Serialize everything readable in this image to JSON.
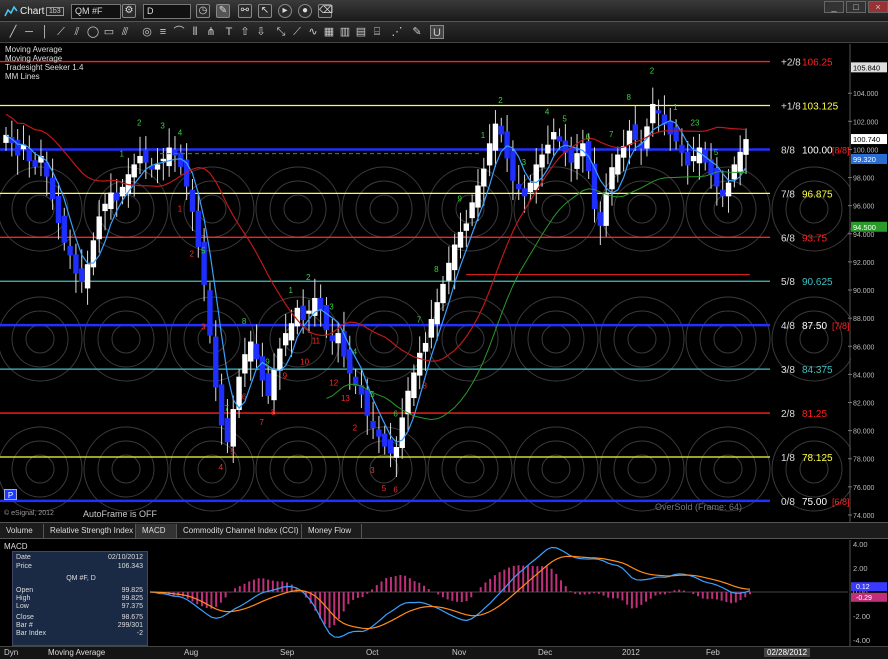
{
  "window": {
    "title": "Chart",
    "badge": "1b3",
    "symbol": "QM #F",
    "interval": "D"
  },
  "studies_list": [
    "Moving Average",
    "Moving Average",
    "Tradesight Seeker 1.4",
    "MM Lines"
  ],
  "chart_data": {
    "type": "candlestick",
    "ylim": [
      73.5,
      107.5
    ],
    "price_axis_ticks": [
      "74.000",
      "76.000",
      "78.000",
      "80.000",
      "82.000",
      "84.000",
      "86.000",
      "88.000",
      "90.000",
      "92.000",
      "94.000",
      "96.000",
      "98.000",
      "100.000",
      "102.000",
      "104.000"
    ],
    "current_price": "100.740",
    "ma_label_1": "99.320",
    "ma_label_2": "94.500",
    "top_label": "105.840",
    "mm_lines": [
      {
        "label": "+2/8",
        "value": "106.250",
        "color": "#ff2020"
      },
      {
        "label": "+1/8",
        "value": "103.125",
        "color": "#ffff40"
      },
      {
        "label": "8/8",
        "value": "100.000",
        "color": "#2030ff",
        "extra": "[8/8]"
      },
      {
        "label": "7/8",
        "value": "96.875",
        "color": "#ffff40"
      },
      {
        "label": "6/8",
        "value": "93.750",
        "color": "#ff2020"
      },
      {
        "label": "5/8",
        "value": "90.625",
        "color": "#40c0c0"
      },
      {
        "label": "4/8",
        "value": "87.500",
        "color": "#2030ff",
        "extra": "[7/8]"
      },
      {
        "label": "3/8",
        "value": "84.375",
        "color": "#40c0c0"
      },
      {
        "label": "2/8",
        "value": "81.250",
        "color": "#ff2020"
      },
      {
        "label": "1/8",
        "value": "78.125",
        "color": "#ffff40"
      },
      {
        "label": "0/8",
        "value": "75.000",
        "color": "#2030ff",
        "extra": "[6/8]"
      }
    ],
    "x_labels": [
      "Aug",
      "Sep",
      "Oct",
      "Nov",
      "Dec",
      "2012",
      "Feb"
    ],
    "closes": [
      101,
      100.5,
      99.6,
      100.3,
      99.2,
      98.8,
      99.5,
      98.1,
      96.5,
      94.8,
      93.4,
      92.5,
      91.2,
      90.6,
      91.8,
      93.5,
      95.2,
      96.1,
      96.9,
      96.4,
      97.3,
      98.2,
      98.9,
      99.5,
      99.1,
      98.6,
      98.9,
      99.3,
      100.1,
      99.6,
      98.8,
      97.4,
      95.6,
      93.1,
      90.4,
      86.8,
      83.1,
      80.4,
      79.2,
      81.5,
      83.8,
      85.4,
      86.3,
      85.1,
      83.6,
      82.5,
      84.3,
      85.8,
      86.9,
      87.6,
      88.7,
      87.9,
      88.5,
      89.4,
      88.6,
      87.2,
      86.4,
      86.9,
      85.3,
      84.1,
      83.2,
      82.6,
      81.1,
      80.2,
      79.6,
      78.9,
      78.4,
      78.8,
      80.9,
      82.8,
      84.1,
      85.5,
      86.2,
      87.9,
      89.1,
      90.4,
      91.9,
      93.2,
      94.1,
      94.7,
      96.2,
      97.4,
      98.6,
      100.4,
      101.8,
      101.1,
      99.4,
      97.8,
      97.2,
      96.7,
      97.6,
      98.9,
      99.6,
      100.3,
      101.2,
      100.6,
      99.8,
      99.1,
      99.7,
      100.4,
      98.5,
      95.8,
      94.6,
      96.9,
      98.7,
      99.6,
      100.2,
      101.3,
      100.7,
      100.1,
      101.6,
      103.2,
      102.6,
      101.8,
      101.1,
      100.6,
      99.8,
      98.9,
      99.5,
      100.1,
      99.1,
      98.2,
      97.4,
      96.7,
      97.6,
      98.9,
      99.8,
      100.7
    ],
    "td_counts_green": [
      "1",
      "2",
      "3",
      "4",
      "5",
      "7",
      "8",
      "9",
      "1",
      "2",
      "3",
      "4",
      "5",
      "6",
      "7",
      "8",
      "9",
      "1",
      "2",
      "3",
      "4",
      "5",
      "6",
      "7",
      "8",
      "2",
      "1",
      "23",
      "5"
    ],
    "td_counts_red": [
      "1",
      "2",
      "3",
      "4",
      "5",
      "6",
      "7",
      "8",
      "9",
      "10",
      "11",
      "12",
      "13",
      "2",
      "3",
      "5",
      "6",
      "7",
      "8"
    ]
  },
  "footer": {
    "copyright": "© eSignal, 2012",
    "autoframe": "AutoFrame is OFF",
    "oversold": "OverSold (Frame: 64)",
    "p_label": "P"
  },
  "tabs": [
    "Volume",
    "Relative Strength Index",
    "MACD",
    "Commodity Channel Index (CCI)",
    "Money Flow"
  ],
  "macd": {
    "title": "MACD",
    "axis": [
      "4.00",
      "2.00",
      "0.00",
      "-2.00",
      "-4.00"
    ],
    "value_labels": [
      "0.12",
      "-0.29"
    ],
    "info": {
      "date_label": "Date",
      "date": "02/10/2012",
      "price_label": "Price",
      "price": "106.343",
      "symbol": "QM #F, D",
      "open_label": "Open",
      "open": "99.825",
      "high_label": "High",
      "high": "99.825",
      "low_label": "Low",
      "low": "97.375",
      "close_label": "Close",
      "close": "98.675",
      "bar_label": "Bar #",
      "bar": "299/301",
      "index_label": "Bar Index",
      "index": "-2",
      "ma_label": "Moving Average"
    }
  },
  "bottom": {
    "left_label": "Dyn",
    "date_box": "02/28/2012",
    "x_labels": [
      "Aug",
      "Sep",
      "Oct",
      "Nov",
      "Dec",
      "2012",
      "Feb"
    ]
  }
}
